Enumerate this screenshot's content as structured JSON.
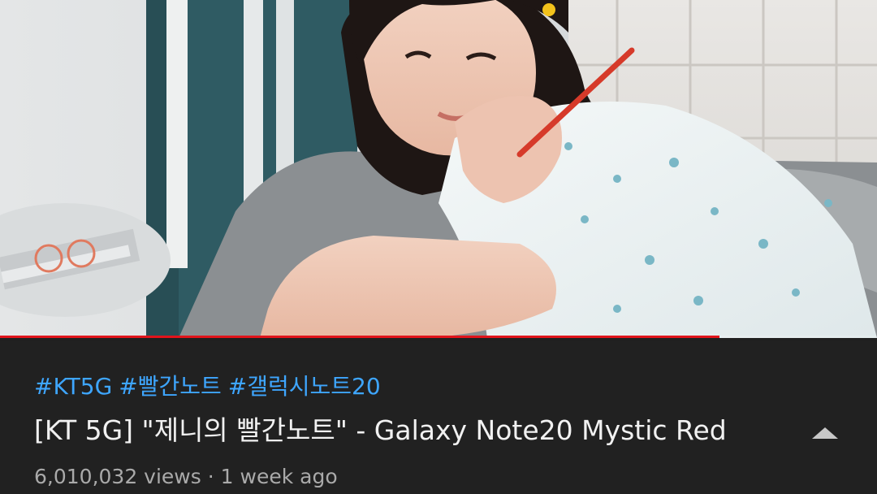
{
  "video": {
    "thumbnail_icon": "video-frame-image",
    "progress": 0.82,
    "progress_color": "#e1141b"
  },
  "meta": {
    "hashtags": [
      "#KT5G",
      "#빨간노트",
      "#갤럭시노트20"
    ],
    "title": "[KT 5G] \"제니의 빨간노트\" - Galaxy Note20 Mystic Red",
    "views": "6,010,032 views",
    "separator": "·",
    "age": "1 week ago",
    "expand_icon": "chevron-up-icon",
    "link_color": "#3ea6ff"
  }
}
